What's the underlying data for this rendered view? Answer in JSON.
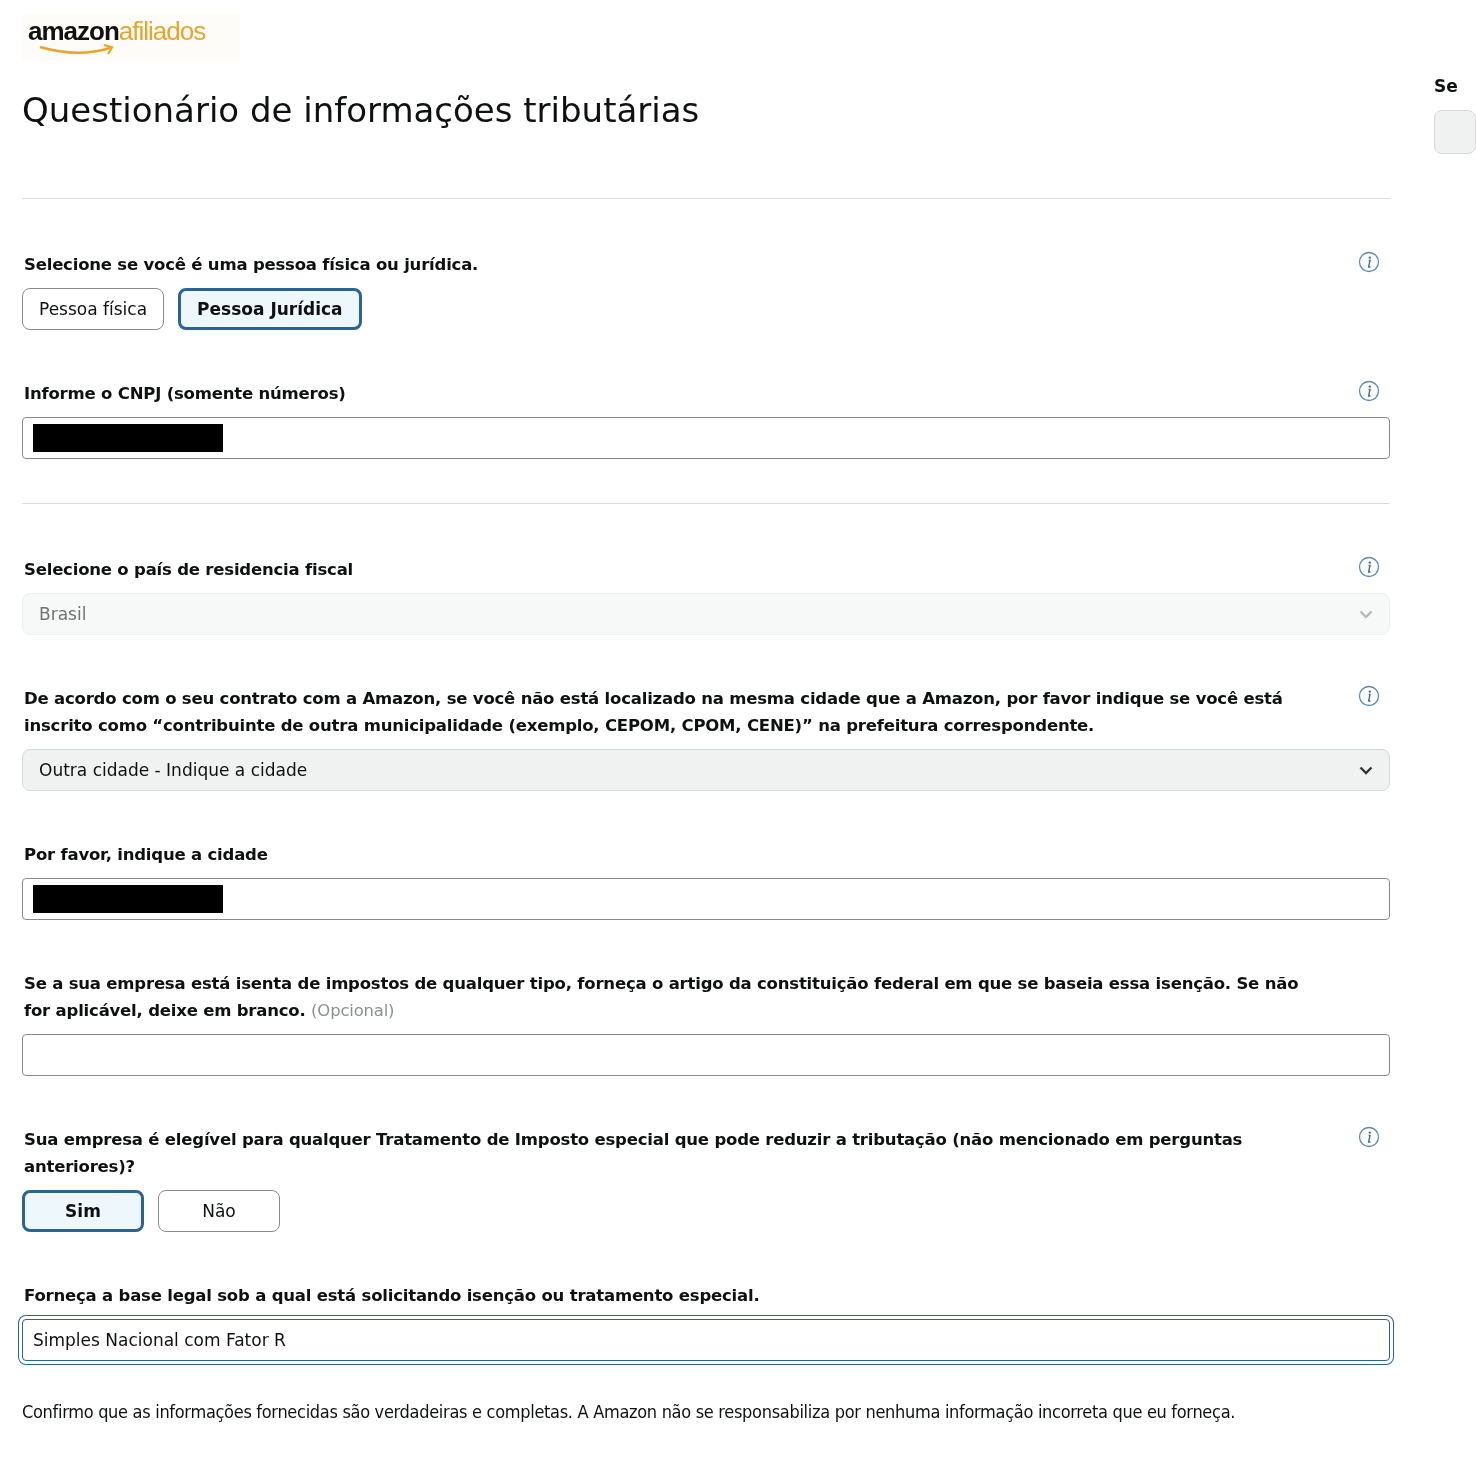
{
  "logo": {
    "brand": "amazon",
    "suffix": "afiliados"
  },
  "title": "Questionário de informações tributárias",
  "side_panel": {
    "label": "Se"
  },
  "questions": [
    {
      "kind": "divider"
    },
    {
      "kind": "choice",
      "label": "Selecione se você é uma pessoa física ou jurídica.",
      "info": true,
      "options": [
        {
          "label": "Pessoa física",
          "selected": false
        },
        {
          "label": "Pessoa Jurídica",
          "selected": true
        }
      ]
    },
    {
      "kind": "text",
      "label": "Informe o CNPJ (somente números)",
      "info": true,
      "redacted": true
    },
    {
      "kind": "divider"
    },
    {
      "kind": "select",
      "label": "Selecione o país de residencia fiscal",
      "info": true,
      "value": "Brasil",
      "disabled": true
    },
    {
      "kind": "select",
      "label": "De acordo com o seu contrato com a Amazon, se você não está localizado na mesma cidade que a Amazon, por favor indique se você está inscrito como “contribuinte de outra municipalidade (exemplo, CEPOM, CPOM, CENE)” na prefeitura correspondente.",
      "info": true,
      "value": "Outra cidade - Indique a cidade",
      "disabled": false
    },
    {
      "kind": "text",
      "label": "Por favor, indique a cidade",
      "info": false,
      "redacted": true
    },
    {
      "kind": "text",
      "label": "Se a sua empresa está isenta de impostos de qualquer tipo, forneça o artigo da constituição federal em que se baseia essa isenção. Se não for aplicável, deixe em branco.",
      "optional": "(Opcional)",
      "info": false,
      "redacted": false
    },
    {
      "kind": "choice",
      "label": "Sua empresa é elegível para qualquer Tratamento de Imposto especial que pode reduzir a tributação (não mencionado em perguntas anteriores)?",
      "info": true,
      "options": [
        {
          "label": "Sim",
          "selected": true
        },
        {
          "label": "Não",
          "selected": false
        }
      ]
    },
    {
      "kind": "text",
      "label": "Forneça a base legal sob a qual está solicitando isenção ou tratamento especial.",
      "info": false,
      "redacted": false,
      "value": "Simples Nacional com Fator R",
      "focused": true
    }
  ],
  "confirmation": "Confirmo que as informações fornecidas são verdadeiras e completas. A Amazon não se responsabiliza por nenhuma informação incorreta que eu forneça."
}
